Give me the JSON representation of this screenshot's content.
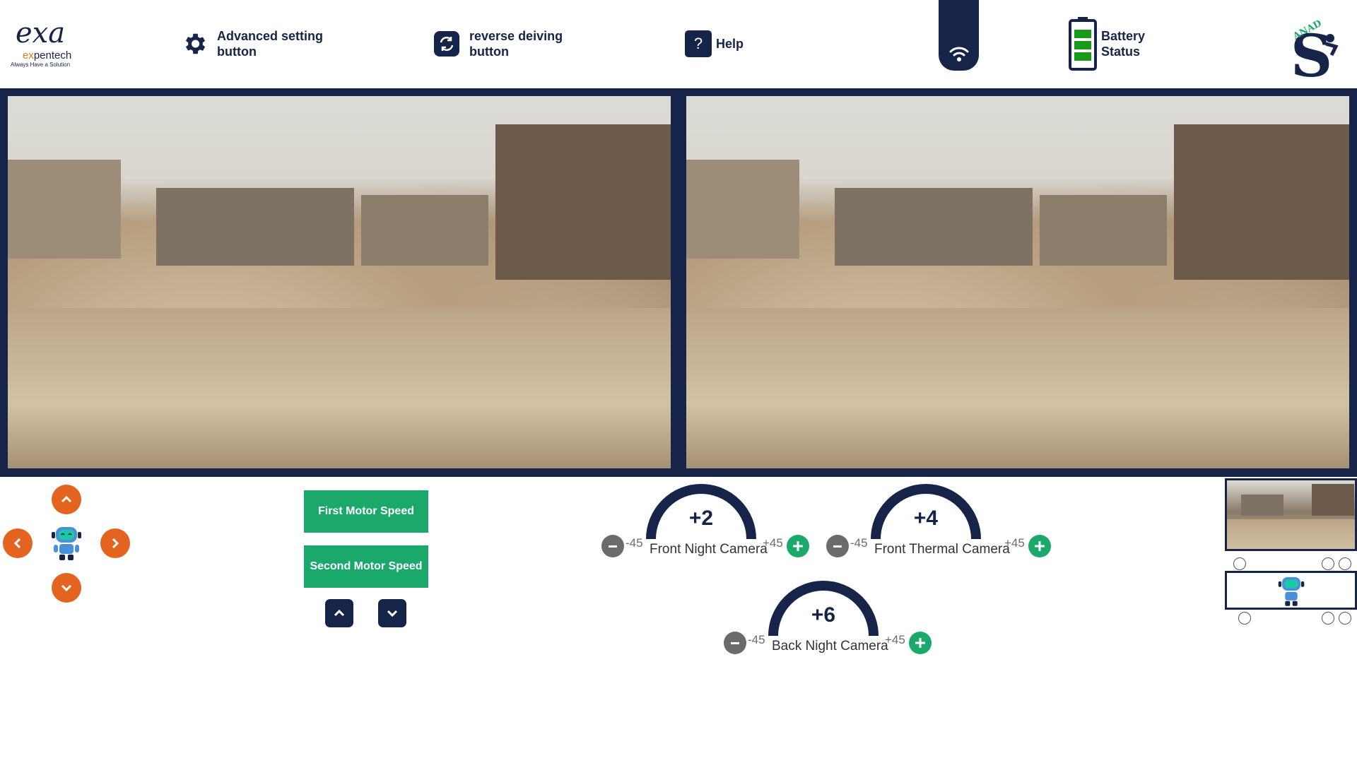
{
  "header": {
    "logo": {
      "mark": "exa",
      "name_prefix": "ex",
      "name_rest": "pentech",
      "tagline": "Always Have a Solution"
    },
    "advanced_setting_label_1": "Advanced setting",
    "advanced_setting_label_2": "button",
    "reverse_label_1": "reverse deiving",
    "reverse_label_2": "button",
    "help_label": "Help",
    "help_glyph": "?",
    "battery_label_1": "Battery",
    "battery_label_2": "Status",
    "battery_level": 0.85,
    "brand_text": "ANAD"
  },
  "icons": {
    "settings": "gear-icon",
    "reverse": "reverse-arrows-icon",
    "help": "question-icon",
    "wifi": "wifi-icon",
    "battery": "battery-icon"
  },
  "colors": {
    "navy": "#17244a",
    "green": "#1aa86b",
    "orange": "#e2641f",
    "grey": "#6b6b6b"
  },
  "controls": {
    "first_motor": "First Motor Speed",
    "second_motor": "Second Motor Speed"
  },
  "gauges": [
    {
      "value": "+2",
      "min": "-45",
      "max": "+45",
      "name": "Front Night Camera"
    },
    {
      "value": "+4",
      "min": "-45",
      "max": "+45",
      "name": "Front Thermal Camera"
    },
    {
      "value": "+6",
      "min": "-45",
      "max": "+45",
      "name": "Back Night Camera"
    }
  ]
}
